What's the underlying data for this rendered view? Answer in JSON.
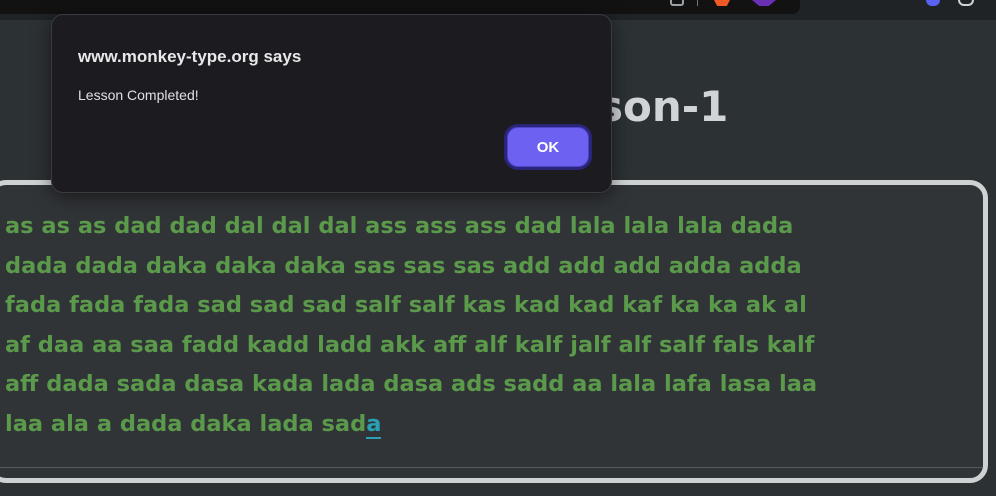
{
  "browser": {
    "toolbar_icons": [
      "tab-icon",
      "brave-shield-icon",
      "extension-icon",
      "extension-icon-2",
      "extension-icon-3"
    ]
  },
  "page": {
    "heading": "son-1"
  },
  "typing": {
    "lines": [
      "as as as dad dad dal dal dal ass ass ass dad lala lala lala dada",
      "dada dada daka daka daka sas sas sas add add add adda adda",
      "fada fada fada sad sad sad salf salf kas kad kad kaf ka ka ak al",
      "af daa aa saa fadd kadd ladd akk aff alf kalf jalf alf salf fals kalf",
      "aff dada sada dasa kada lada dasa ads sadd aa lala lafa lasa laa",
      "laa ala a dada daka lada sad"
    ],
    "current_char": "a",
    "colors": {
      "typed": "#5a9a4a",
      "current": "#2aa0b4"
    }
  },
  "dialog": {
    "title": "www.monkey-type.org says",
    "message": "Lesson Completed!",
    "ok_label": "OK",
    "accent": "#6c61f0"
  }
}
